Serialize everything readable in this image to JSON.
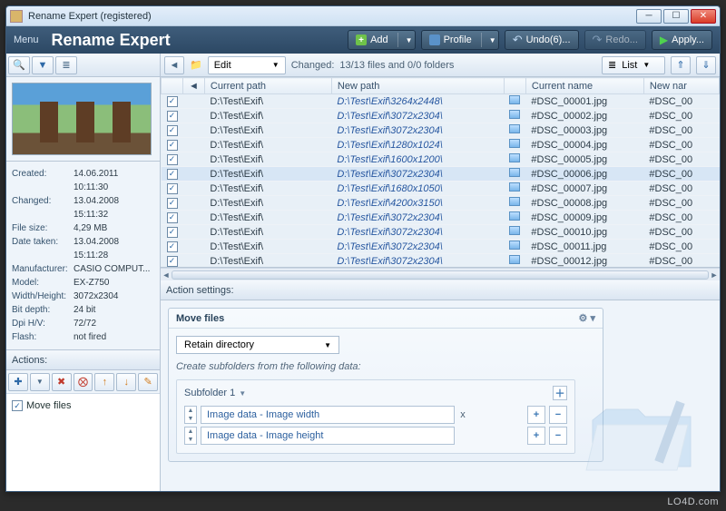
{
  "window_title": "Rename Expert (registered)",
  "app_title": "Rename Expert",
  "menu": {
    "menu_label": "Menu"
  },
  "toolbar": {
    "add": "Add",
    "profile": "Profile",
    "undo": "Undo(6)...",
    "redo": "Redo...",
    "apply": "Apply..."
  },
  "left": {
    "actions_header": "Actions:",
    "meta": [
      {
        "k": "Created:",
        "v": "14.06.2011 10:11:30"
      },
      {
        "k": "Changed:",
        "v": "13.04.2008 15:11:32"
      },
      {
        "k": "File size:",
        "v": "4,29 MB"
      },
      {
        "k": "Date taken:",
        "v": "13.04.2008 15:11:28"
      },
      {
        "k": "Manufacturer:",
        "v": "CASIO COMPUT..."
      },
      {
        "k": "Model:",
        "v": "EX-Z750"
      },
      {
        "k": "Width/Height:",
        "v": "3072x2304"
      },
      {
        "k": "Bit depth:",
        "v": "24 bit"
      },
      {
        "k": "Dpi H/V:",
        "v": "72/72"
      },
      {
        "k": "Flash:",
        "v": "not fired"
      }
    ],
    "action_item": "Move files"
  },
  "right_toolbar": {
    "edit": "Edit",
    "changed_label": "Changed:",
    "changed_value": "13/13 files and 0/0 folders",
    "list_label": "List"
  },
  "columns": {
    "current_path": "Current path",
    "new_path": "New path",
    "current_name": "Current name",
    "new_name": "New nar"
  },
  "rows": [
    {
      "cp": "D:\\Test\\Exif\\",
      "np": "D:\\Test\\Exif\\3264x2448\\",
      "cn": "#DSC_00001.jpg",
      "nn": "#DSC_00"
    },
    {
      "cp": "D:\\Test\\Exif\\",
      "np": "D:\\Test\\Exif\\3072x2304\\",
      "cn": "#DSC_00002.jpg",
      "nn": "#DSC_00"
    },
    {
      "cp": "D:\\Test\\Exif\\",
      "np": "D:\\Test\\Exif\\3072x2304\\",
      "cn": "#DSC_00003.jpg",
      "nn": "#DSC_00"
    },
    {
      "cp": "D:\\Test\\Exif\\",
      "np": "D:\\Test\\Exif\\1280x1024\\",
      "cn": "#DSC_00004.jpg",
      "nn": "#DSC_00"
    },
    {
      "cp": "D:\\Test\\Exif\\",
      "np": "D:\\Test\\Exif\\1600x1200\\",
      "cn": "#DSC_00005.jpg",
      "nn": "#DSC_00"
    },
    {
      "cp": "D:\\Test\\Exif\\",
      "np": "D:\\Test\\Exif\\3072x2304\\",
      "cn": "#DSC_00006.jpg",
      "nn": "#DSC_00",
      "sel": true
    },
    {
      "cp": "D:\\Test\\Exif\\",
      "np": "D:\\Test\\Exif\\1680x1050\\",
      "cn": "#DSC_00007.jpg",
      "nn": "#DSC_00"
    },
    {
      "cp": "D:\\Test\\Exif\\",
      "np": "D:\\Test\\Exif\\4200x3150\\",
      "cn": "#DSC_00008.jpg",
      "nn": "#DSC_00"
    },
    {
      "cp": "D:\\Test\\Exif\\",
      "np": "D:\\Test\\Exif\\3072x2304\\",
      "cn": "#DSC_00009.jpg",
      "nn": "#DSC_00"
    },
    {
      "cp": "D:\\Test\\Exif\\",
      "np": "D:\\Test\\Exif\\3072x2304\\",
      "cn": "#DSC_00010.jpg",
      "nn": "#DSC_00"
    },
    {
      "cp": "D:\\Test\\Exif\\",
      "np": "D:\\Test\\Exif\\3072x2304\\",
      "cn": "#DSC_00011.jpg",
      "nn": "#DSC_00"
    },
    {
      "cp": "D:\\Test\\Exif\\",
      "np": "D:\\Test\\Exif\\3072x2304\\",
      "cn": "#DSC_00012.jpg",
      "nn": "#DSC_00"
    }
  ],
  "settings": {
    "header": "Action settings:",
    "panel_title": "Move files",
    "retain_dir": "Retain directory",
    "help": "Create subfolders from the following data:",
    "subfolder_label": "Subfolder 1",
    "field1": "Image data - Image width",
    "field2": "Image data - Image height",
    "x": "x"
  },
  "footer": "LO4D.com"
}
